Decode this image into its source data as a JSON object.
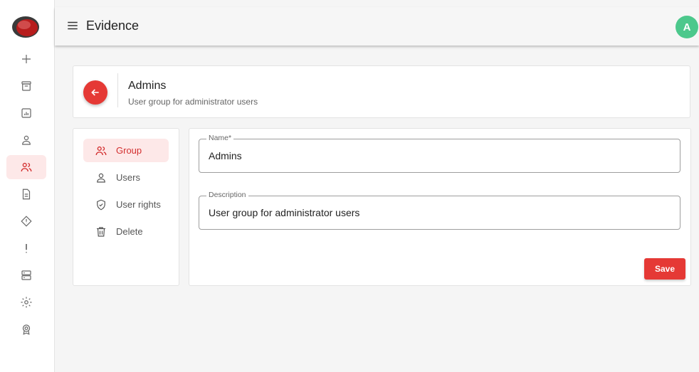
{
  "app": {
    "title": "Evidence",
    "avatar_initial": "A"
  },
  "rail": {
    "items": [
      {
        "icon": "plus-icon",
        "label": ""
      },
      {
        "icon": "archive-icon",
        "label": ""
      },
      {
        "icon": "report-icon",
        "label": ""
      },
      {
        "icon": "user-icon",
        "label": ""
      },
      {
        "icon": "group-icon",
        "label": "",
        "active": true
      },
      {
        "icon": "document-icon",
        "label": ""
      },
      {
        "icon": "diamond-alert-icon",
        "label": ""
      },
      {
        "icon": "exclamation-icon",
        "label": ""
      },
      {
        "icon": "server-icon",
        "label": ""
      },
      {
        "icon": "gear-icon",
        "label": ""
      },
      {
        "icon": "badge-icon",
        "label": ""
      }
    ]
  },
  "group": {
    "title": "Admins",
    "subtitle": "User group for administrator users"
  },
  "side_menu": {
    "items": [
      {
        "label": "Group",
        "icon": "group-icon",
        "active": true
      },
      {
        "label": "Users",
        "icon": "user-icon"
      },
      {
        "label": "User rights",
        "icon": "shield-check-icon"
      },
      {
        "label": "Delete",
        "icon": "trash-icon"
      }
    ]
  },
  "form": {
    "name": {
      "label": "Name*",
      "value": "Admins"
    },
    "description": {
      "label": "Description",
      "value": "User group for administrator users"
    },
    "save_label": "Save"
  },
  "colors": {
    "accent": "#e53935",
    "accent_light": "#fde8e8",
    "avatar": "#4cc88c"
  }
}
